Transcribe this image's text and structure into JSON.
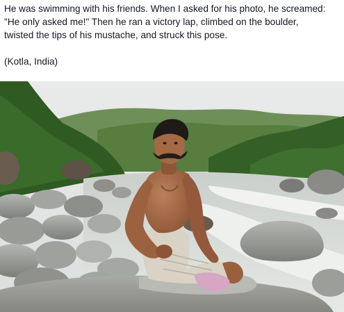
{
  "post": {
    "caption_lines": [
      "He was swimming with his friends. When I asked for his photo, he screamed:",
      "\"He only asked me!\" Then he ran a victory lap, climbed on the boulder,",
      "twisted the tips of his mustache, and struck this pose."
    ],
    "location": "(Kotla, India)"
  },
  "photo": {
    "subject": "man with mustache seated on a river boulder",
    "scene": "rocky river with rapids and green forested hills"
  },
  "colors": {
    "text": "#141823",
    "background": "#ffffff",
    "sky": "#e4e6e6",
    "forest": "#3f6a2c",
    "water": "#d7dcd8",
    "rock": "#9a9c98",
    "skin": "#a56a46"
  }
}
